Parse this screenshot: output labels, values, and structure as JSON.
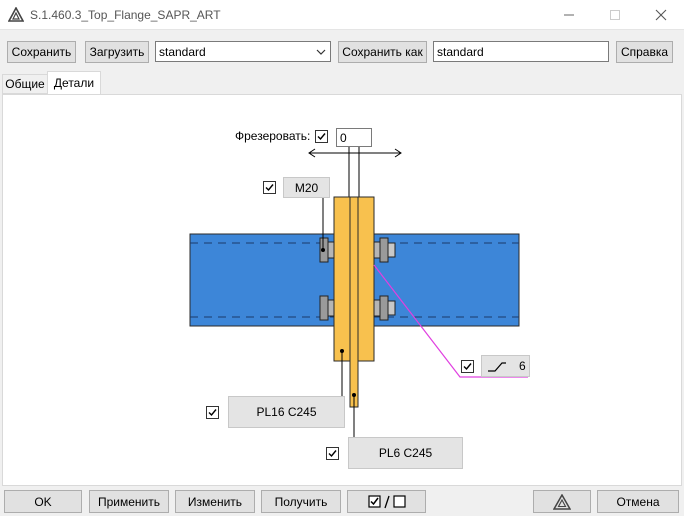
{
  "window": {
    "title": "S.1.460.3_Top_Flange_SAPR_ART"
  },
  "toolbar": {
    "save_label": "Сохранить",
    "load_label": "Загрузить",
    "preset_value": "standard",
    "save_as_label": "Сохранить как",
    "save_as_value": "standard",
    "help_label": "Справка"
  },
  "tabs": [
    {
      "label": "Общие",
      "active": false
    },
    {
      "label": "Детали",
      "active": true
    }
  ],
  "details": {
    "mill_label": "Фрезеровать:",
    "mill_checked": true,
    "mill_value": "0",
    "bolt_checked": true,
    "bolt_label": "M20",
    "weld_checked": true,
    "weld_size": "6",
    "plate1_checked": true,
    "plate1_label": "PL16 C245",
    "plate2_checked": true,
    "plate2_label": "PL6 C245"
  },
  "colors": {
    "beam": "#3d86d8",
    "plate": "#f8c14e",
    "weld_line": "#e040e0"
  },
  "bottom": {
    "ok_label": "OK",
    "apply_label": "Применить",
    "modify_label": "Изменить",
    "get_label": "Получить",
    "cancel_label": "Отмена"
  }
}
